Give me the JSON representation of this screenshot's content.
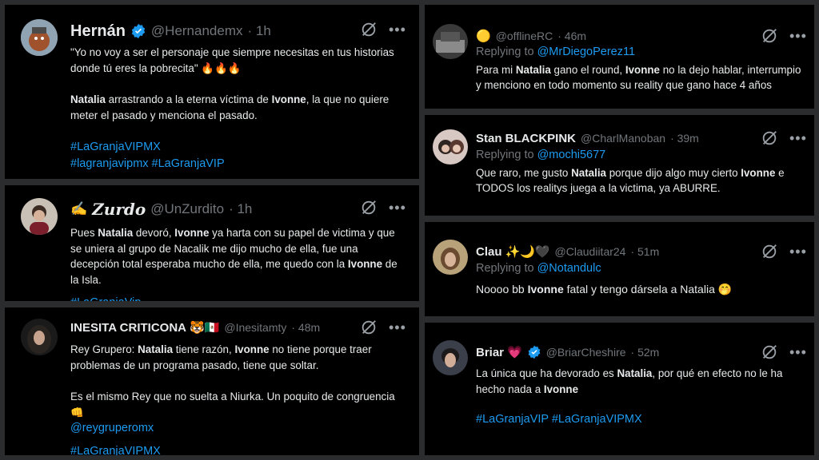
{
  "tweets": [
    {
      "name": "Hernán",
      "handle": "@Hernandemx",
      "time": "· 1h",
      "verified": true,
      "t1": "\"Yo no voy a ser el personaje que siempre necesitas en tus historias donde tú eres la pobrecita\" 🔥🔥🔥",
      "t2a": "Natalia",
      "t2b": " arrastrando a la eterna víctima de ",
      "t2c": "Ivonne",
      "t2d": ", la que no quiere meter el pasado y menciona el pasado.",
      "h1": "#LaGranjaVIPMX",
      "h2": "#lagranjavipmx #LaGranjaVIP"
    },
    {
      "prefix": "✍️",
      "name": "Zurdo",
      "handle": "@UnZurdito",
      "time": "· 1h",
      "t1a": "Pues ",
      "t1b": "Natalia",
      "t1c": " devoró, ",
      "t1d": "Ivonne",
      "t1e": " ya harta con su papel de victima y que se uniera al grupo de Nacalik me dijo mucho de ella, fue una decepción total esperaba mucho de ella, me quedo con la ",
      "t1f": "Ivonne",
      "t1g": " de la Isla.",
      "h1": "#LaGranjaVip"
    },
    {
      "name": "INESITA CRITICONA",
      "emoji": "🐯🇲🇽",
      "handle": "@Inesitamty",
      "time": "· 48m",
      "t1a": "Rey Grupero: ",
      "t1b": "Natalia",
      "t1c": " tiene razón, ",
      "t1d": "Ivonne",
      "t1e": " no tiene porque traer problemas de un programa pasado, tiene que soltar.",
      "t2": "Es el mismo Rey que no suelta a Niurka. Un poquito de congruencia 👊",
      "mention": "@reygruperomx",
      "h1": "#LaGranjaVIPMX"
    },
    {
      "prefix": "🟡",
      "handle": "@offlineRC",
      "time": "· 46m",
      "reply_label": "Replying to",
      "reply_to": "@MrDiegoPerez11",
      "t1a": "Para mi ",
      "t1b": "Natalia",
      "t1c": " gano el round, ",
      "t1d": "Ivonne",
      "t1e": " no la dejo hablar, interrumpio y menciono en todo momento su reality que gano hace 4 años"
    },
    {
      "name": "Stan BLACKPINK",
      "handle": "@CharlManoban",
      "time": "· 39m",
      "reply_label": "Replying to",
      "reply_to": "@mochi5677",
      "t1a": "Que raro, me gusto ",
      "t1b": "Natalia",
      "t1c": " porque dijo algo muy cierto ",
      "t1d": "Ivonne",
      "t1e": " e TODOS los realitys juega a la victima, ya ABURRE."
    },
    {
      "name": "Clau",
      "emoji": "✨🌙🖤",
      "handle": "@Claudiitar24",
      "time": "· 51m",
      "reply_label": "Replying to",
      "reply_to": "@Notandulc",
      "t1a": "Noooo bb ",
      "t1b": "Ivonne",
      "t1c": " fatal y tengo dársela a Natalia 🤭"
    },
    {
      "name": "Briar",
      "emoji": "💗",
      "handle": "@BriarCheshire",
      "time": "· 52m",
      "verified": true,
      "t1a": "La única que ha devorado es ",
      "t1b": "Natalia",
      "t1c": ", por qué en efecto no le ha hecho nada a ",
      "t1d": "Ivonne",
      "h1": "#LaGranjaVIP #LaGranjaVIPMX"
    }
  ],
  "more_glyph": "•••",
  "colors": {
    "background": "#000000",
    "frame": "#2b2c2e",
    "link": "#1d9bf0",
    "muted": "#71767b",
    "verified": "#1d9bf0"
  }
}
